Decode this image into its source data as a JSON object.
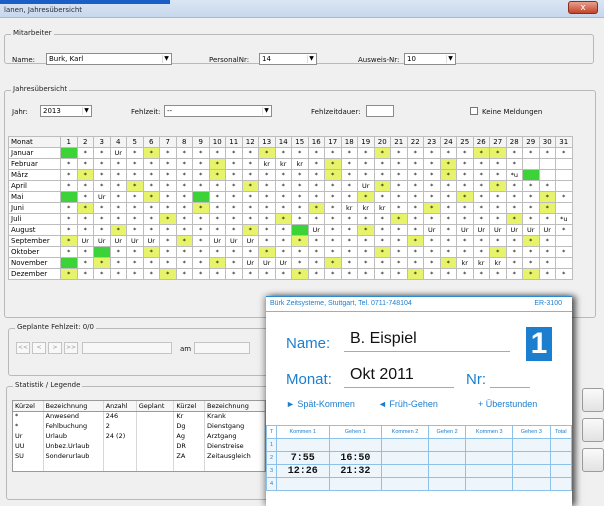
{
  "window": {
    "title": "lanen, Jahresübersicht",
    "close_glyph": "x"
  },
  "mitarbeiter": {
    "legend": "Mitarbeiter",
    "name_label": "Name:",
    "name_value": "Burk, Karl",
    "personalnr_label": "PersonalNr:",
    "personalnr_value": "14",
    "ausweisnr_label": "Ausweis-Nr:",
    "ausweisnr_value": "10"
  },
  "jahresuebersicht": {
    "legend": "Jahresübersicht",
    "jahr_label": "Jahr:",
    "jahr_value": "2013",
    "fehlzeit_label": "Fehlzeit:",
    "fehlzeit_value": "--",
    "fehlzeitdauer_label": "Fehlzeitdauer:",
    "keine_meldungen_label": "Keine Meldungen"
  },
  "calendar": {
    "month_header": "Monat",
    "days": [
      "1",
      "2",
      "3",
      "4",
      "5",
      "6",
      "7",
      "8",
      "9",
      "10",
      "11",
      "12",
      "13",
      "14",
      "15",
      "16",
      "17",
      "18",
      "19",
      "20",
      "21",
      "22",
      "23",
      "24",
      "25",
      "26",
      "27",
      "28",
      "29",
      "30",
      "31"
    ],
    "months": [
      {
        "name": "Januar",
        "cells": [
          "ab",
          "*",
          "*",
          "Ur",
          "*",
          "we",
          "*",
          "*",
          "*",
          "*",
          "*",
          "*",
          "we",
          "*",
          "*",
          "*",
          "*",
          "*",
          "*",
          "we",
          "*",
          "*",
          "*",
          "*",
          "*",
          "we",
          "we",
          "*",
          "*",
          "*",
          "*"
        ]
      },
      {
        "name": "Februar",
        "cells": [
          "*",
          "*",
          "*",
          "*",
          "*",
          "*",
          "*",
          "*",
          "*",
          "we",
          "*",
          "*",
          "kr",
          "kr",
          "kr",
          "*",
          "we",
          "*",
          "*",
          "*",
          "*",
          "*",
          "*",
          "we",
          "*",
          "*",
          "*",
          "*",
          "",
          "",
          ""
        ]
      },
      {
        "name": "März",
        "cells": [
          "*",
          "we",
          "*",
          "*",
          "*",
          "*",
          "*",
          "*",
          "*",
          "we",
          "*",
          "*",
          "*",
          "*",
          "*",
          "*",
          "we",
          "*",
          "*",
          "*",
          "*",
          "*",
          "*",
          "we",
          "*",
          "*",
          "*",
          "*u",
          "ab",
          "",
          ""
        ]
      },
      {
        "name": "April",
        "cells": [
          "*",
          "*",
          "*",
          "*",
          "we",
          "*",
          "*",
          "*",
          "*",
          "*",
          "*",
          "we",
          "*",
          "*",
          "*",
          "*",
          "*",
          "*",
          "Ur",
          "we",
          "*",
          "*",
          "*",
          "*",
          "*",
          "*",
          "we",
          "*",
          "*",
          "*",
          ""
        ]
      },
      {
        "name": "Mai",
        "cells": [
          "ab",
          "*",
          "Ur",
          "*",
          "*",
          "we",
          "*",
          "*",
          "ab",
          "*",
          "*",
          "*",
          "*",
          "*",
          "*",
          "*",
          "*",
          "*",
          "we",
          "*",
          "*",
          "*",
          "*",
          "*",
          "we",
          "*",
          "*",
          "*",
          "*",
          "we",
          "*"
        ]
      },
      {
        "name": "Juni",
        "cells": [
          "*",
          "we",
          "*",
          "*",
          "*",
          "*",
          "*",
          "*",
          "we",
          "*",
          "*",
          "*",
          "*",
          "*",
          "*",
          "we",
          "*",
          "kr",
          "kr",
          "kr",
          "*",
          "*",
          "we",
          "*",
          "*",
          "*",
          "*",
          "*",
          "*",
          "we",
          ""
        ]
      },
      {
        "name": "Juli",
        "cells": [
          "*",
          "*",
          "*",
          "*",
          "*",
          "*",
          "we",
          "*",
          "*",
          "*",
          "*",
          "*",
          "*",
          "we",
          "*",
          "*",
          "*",
          "*",
          "*",
          "*",
          "we",
          "*",
          "*",
          "*",
          "*",
          "*",
          "*",
          "we",
          "*",
          "*",
          "*u"
        ]
      },
      {
        "name": "August",
        "cells": [
          "*",
          "*",
          "*",
          "we",
          "*",
          "*",
          "*",
          "*",
          "*",
          "*",
          "*",
          "we",
          "*",
          "*",
          "ab",
          "Ur",
          "*",
          "*",
          "we",
          "*",
          "*",
          "*",
          "Ur",
          "*",
          "Ur",
          "Ur",
          "Ur",
          "Ur",
          "Ur",
          "Ur",
          "*"
        ]
      },
      {
        "name": "September",
        "cells": [
          "we",
          "Ur",
          "Ur",
          "Ur",
          "Ur",
          "Ur",
          "*",
          "we",
          "*",
          "Ur",
          "Ur",
          "Ur",
          "*",
          "*",
          "we",
          "*",
          "*",
          "*",
          "*",
          "*",
          "*",
          "we",
          "*",
          "*",
          "*",
          "*",
          "*",
          "*",
          "we",
          "*",
          ""
        ]
      },
      {
        "name": "Oktober",
        "cells": [
          "*",
          "*",
          "ab",
          "*",
          "*",
          "we",
          "*",
          "*",
          "*",
          "*",
          "*",
          "*",
          "we",
          "*",
          "*",
          "*",
          "*",
          "*",
          "*",
          "we",
          "*",
          "*",
          "*",
          "*",
          "*",
          "*",
          "we",
          "*",
          "*",
          "*",
          "*"
        ]
      },
      {
        "name": "November",
        "cells": [
          "ab",
          "*",
          "we",
          "*",
          "*",
          "*",
          "*",
          "*",
          "*",
          "we",
          "*",
          "Ur",
          "Ur",
          "Ur",
          "*",
          "*",
          "we",
          "*",
          "*",
          "*",
          "*",
          "*",
          "*",
          "we",
          "kr",
          "kr",
          "kr",
          "*",
          "*",
          "*",
          ""
        ]
      },
      {
        "name": "Dezember",
        "cells": [
          "we",
          "*",
          "*",
          "*",
          "*",
          "*",
          "we",
          "*",
          "*",
          "*",
          "*",
          "*",
          "*",
          "*",
          "we",
          "*",
          "*",
          "*",
          "*",
          "*",
          "*",
          "we",
          "*",
          "*",
          "*",
          "*",
          "*",
          "*",
          "we",
          "*",
          "*"
        ]
      }
    ]
  },
  "geplante": {
    "legend": "Geplante Fehlzeit: 0/0",
    "first": "<<",
    "prev": "<",
    "next": ">",
    "last": ">>",
    "am_label": "am"
  },
  "statistik": {
    "legend": "Statistik / Legende",
    "headers": [
      "Kürzel",
      "Bezeichnung",
      "Anzahl",
      "Geplant",
      "Kürzel",
      "Bezeichnung"
    ],
    "rows": [
      [
        "*",
        "Anwesend",
        "246",
        "",
        "Kr",
        "Krank"
      ],
      [
        "*",
        "Fehlbuchung",
        "2",
        "",
        "Dg",
        "Dienstgang"
      ],
      [
        "Ur",
        "Urlaub",
        "24 (2)",
        "",
        "Ag",
        "Arztgang"
      ],
      [
        "UU",
        "Unbez.Urlaub",
        "",
        "",
        "DR",
        "Dienstreise"
      ],
      [
        "SU",
        "Sonderurlaub",
        "",
        "",
        "ZA",
        "Zeitausgleich"
      ],
      [
        "",
        "",
        "",
        "",
        "",
        ""
      ]
    ]
  },
  "timecard": {
    "company": "Bürk Zeitsysteme, Stuttgart, Tel. 0711-748104",
    "model": "ER-3100",
    "name_label": "Name:",
    "name_value": "B. Eispiel",
    "monat_label": "Monat:",
    "monat_value": "Okt 2011",
    "nr_label": "Nr:",
    "card_number": "1",
    "legend_spaet": "► Spät-Kommen",
    "legend_frueh": "◄ Früh-Gehen",
    "legend_ueber": "+ Überstunden",
    "columns": [
      "T",
      "Kommen 1",
      "Gehen 1",
      "Kommen 2",
      "Gehen 2",
      "Kommen 3",
      "Gehen 3",
      "Total"
    ],
    "rows": [
      [
        "1",
        "",
        "",
        "",
        "",
        "",
        "",
        ""
      ],
      [
        "2",
        "7:55",
        "16:50",
        "",
        "",
        "",
        "",
        ""
      ],
      [
        "3",
        "12:26",
        "21:32",
        "",
        "",
        "",
        "",
        ""
      ],
      [
        "4",
        "",
        "",
        "",
        "",
        "",
        "",
        ""
      ]
    ]
  }
}
